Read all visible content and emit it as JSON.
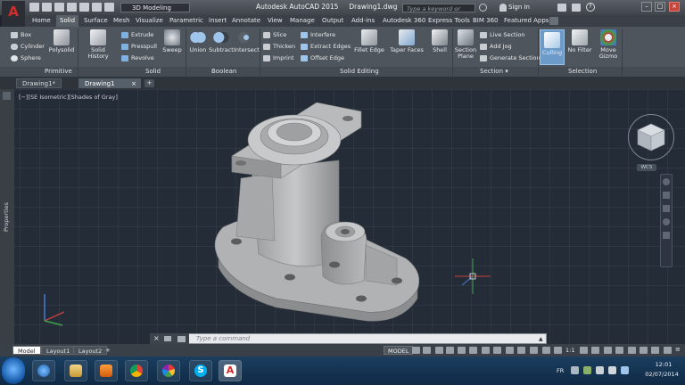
{
  "title_bar": {
    "workspace": "3D Modeling",
    "app_title": "Autodesk AutoCAD 2015",
    "doc_title": "Drawing1.dwg",
    "search_placeholder": "Type a keyword or phrase",
    "sign_in": "Sign In"
  },
  "ribbon_tabs": [
    {
      "label": "Home"
    },
    {
      "label": "Solid"
    },
    {
      "label": "Surface"
    },
    {
      "label": "Mesh"
    },
    {
      "label": "Visualize"
    },
    {
      "label": "Parametric"
    },
    {
      "label": "Insert"
    },
    {
      "label": "Annotate"
    },
    {
      "label": "View"
    },
    {
      "label": "Manage"
    },
    {
      "label": "Output"
    },
    {
      "label": "Add-ins"
    },
    {
      "label": "Autodesk 360"
    },
    {
      "label": "Express Tools"
    },
    {
      "label": "BIM 360"
    },
    {
      "label": "Featured Apps"
    }
  ],
  "ribbon": {
    "primitive": {
      "box": "Box",
      "cylinder": "Cylinder",
      "sphere": "Sphere",
      "polysolid": "Polysolid",
      "label": "Primitive"
    },
    "solid": {
      "solid_history": "Solid History",
      "extrude": "Extrude",
      "presspull": "Presspull",
      "revolve": "Revolve",
      "sweep": "Sweep",
      "label": "Solid"
    },
    "boolean": {
      "union": "Union",
      "subtract": "Subtract",
      "intersect": "Intersect",
      "label": "Boolean"
    },
    "solid_editing": {
      "slice": "Slice",
      "thicken": "Thicken",
      "imprint": "Imprint",
      "interfere": "Interfere",
      "extract_edges": "Extract Edges",
      "offset_edge": "Offset Edge",
      "fillet_edge": "Fillet Edge",
      "taper_faces": "Taper Faces",
      "shell": "Shell",
      "label": "Solid Editing"
    },
    "section": {
      "section_plane_1": "Section",
      "section_plane_2": "Plane",
      "live_section": "Live Section",
      "add_jog": "Add Jog",
      "generate_section": "Generate Section",
      "label": "Section"
    },
    "selection": {
      "culling": "Culling",
      "no_filter": "No Filter",
      "move_gizmo_1": "Move",
      "move_gizmo_2": "Gizmo",
      "label": "Selection"
    }
  },
  "doc_tabs": [
    {
      "label": "Drawing1*"
    },
    {
      "label": "Drawing1"
    }
  ],
  "viewport": {
    "label": "[−][SE Isometric][Shades of Gray]",
    "properties": "Properties",
    "wcs": "WCS"
  },
  "command": {
    "placeholder": "Type a command"
  },
  "layout_tabs": [
    {
      "label": "Model"
    },
    {
      "label": "Layout1"
    },
    {
      "label": "Layout2"
    }
  ],
  "status": {
    "model": "MODEL",
    "scale": "1:1"
  },
  "tray": {
    "lang": "FR",
    "time": "12:01",
    "date": "02/07/2014"
  },
  "colors": {
    "accent": "#4a9fe0",
    "model_gray": "#a9aaab",
    "viewport_bg": "#242c37"
  }
}
